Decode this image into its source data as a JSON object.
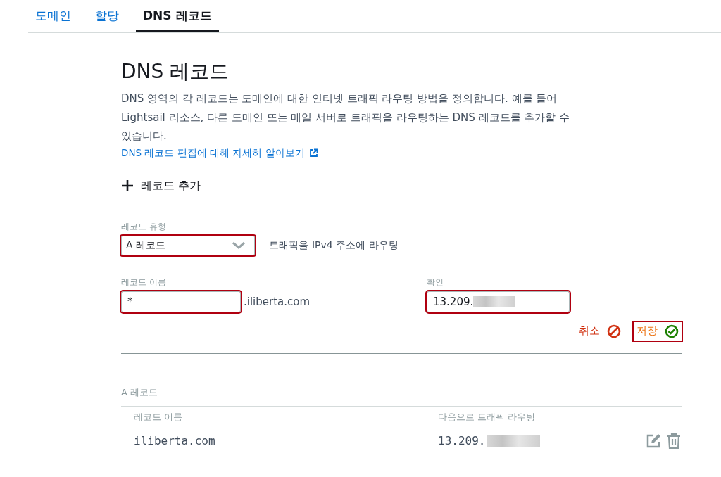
{
  "tabs": [
    {
      "label": "도메인",
      "selected": false
    },
    {
      "label": "할당",
      "selected": false
    },
    {
      "label": "DNS 레코드",
      "selected": true
    }
  ],
  "title": "DNS 레코드",
  "description_lines": [
    "DNS 영역의 각 레코드는 도메인에 대한 인터넷 트래픽 라우팅 방법을 정의합니다. 예를 들어",
    "Lightsail 리소스, 다른 도메인 또는 메일 서버로 트래픽을 라우팅하는 DNS 레코드를 추가할 수",
    "있습니다."
  ],
  "learn_more_link": "DNS 레코드 편집에 대해 자세히 알아보기",
  "add_record_button": "레코드 추가",
  "form": {
    "record_type": {
      "label": "레코드 유형",
      "value": "A 레코드",
      "hint": "— 트래픽을 IPv4 주소에 라우팅",
      "highlighted": true
    },
    "record_name": {
      "label": "레코드 이름",
      "value": "*",
      "suffix": ".iliberta.com",
      "highlighted": true
    },
    "resolves_to": {
      "label": "확인",
      "value": "13.209.",
      "redacted": true,
      "highlighted": true
    },
    "actions": [
      {
        "kind": "cancel",
        "label": "취소",
        "highlighted": false
      },
      {
        "kind": "save",
        "label": "저장",
        "highlighted": true
      }
    ]
  },
  "table": {
    "title": "A 레코드",
    "columns": [
      "레코드 이름",
      "다음으로 트래픽 라우팅"
    ],
    "rows": [
      {
        "name": "iliberta.com",
        "target": "13.209.",
        "redacted": true
      }
    ]
  }
}
